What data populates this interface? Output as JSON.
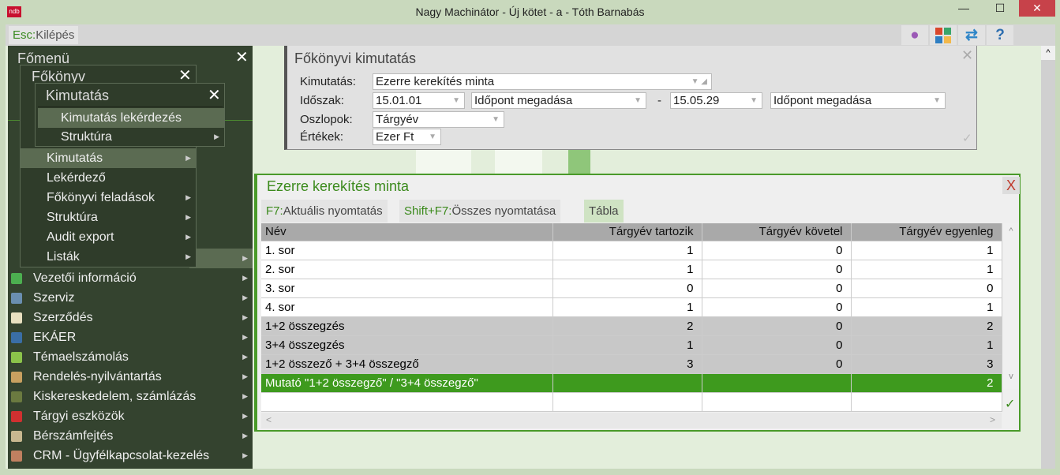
{
  "window": {
    "title": "Nagy Machinátor - Új kötet - a - Tóth Barnabás",
    "app_icon": "ndb",
    "minimize": "—",
    "maximize": "☐",
    "close": "✕"
  },
  "toolbar": {
    "esc_key": "Esc:",
    "esc_label": "Kilépés",
    "icons": [
      "user-icon",
      "tiles-icon",
      "swap-icon",
      "help-icon"
    ],
    "help": "?"
  },
  "main_menu": {
    "title": "Főmenü",
    "close": "✕",
    "items": [
      {
        "label": "Vezetői információ",
        "color": "#4caf50"
      },
      {
        "label": "Szerviz",
        "color": "#6a8fb0"
      },
      {
        "label": "Szerződés",
        "color": "#e8e0c0"
      },
      {
        "label": "EKÁER",
        "color": "#3a6ea5"
      },
      {
        "label": "Témaelszámolás",
        "color": "#8bc34a"
      },
      {
        "label": "Rendelés-nyilvántartás",
        "color": "#c8a060"
      },
      {
        "label": "Kiskereskedelem, számlázás",
        "color": "#6b7a40"
      },
      {
        "label": "Tárgyi eszközök",
        "color": "#d03030"
      },
      {
        "label": "Bérszámfejtés",
        "color": "#c8b890"
      },
      {
        "label": "CRM - Ügyfélkapcsolat-kezelés",
        "color": "#c08060"
      }
    ]
  },
  "fokonyv_menu": {
    "title": "Főkönyv",
    "close": "✕",
    "items": [
      "Kimutatás",
      "Lekérdező",
      "Főkönyvi feladások",
      "Struktúra",
      "Audit export",
      "Listák"
    ]
  },
  "kimutatas_menu": {
    "title": "Kimutatás",
    "close": "✕",
    "items": [
      "Kimutatás lekérdezés",
      "Struktúra"
    ]
  },
  "form": {
    "title": "Főkönyvi kimutatás",
    "close": "✕",
    "ok": "✓",
    "kimutatas_label": "Kimutatás:",
    "kimutatas_value": "Ezerre kerekítés minta",
    "idoszak_label": "Időszak:",
    "from_date": "15.01.01",
    "from_mode": "Időpont megadása",
    "dash": "-",
    "to_date": "15.05.29",
    "to_mode": "Időpont megadása",
    "oszlopok_label": "Oszlopok:",
    "oszlopok_value": "Tárgyév",
    "ertekek_label": "Értékek:",
    "ertekek_value": "Ezer Ft"
  },
  "result": {
    "title": "Ezerre kerekítés minta",
    "close": "X",
    "tabs": [
      {
        "key": "F7:",
        "label": "Aktuális nyomtatás"
      },
      {
        "key": "Shift+F7:",
        "label": "Összes nyomtatása"
      },
      {
        "key": "",
        "label": "Tábla"
      }
    ],
    "columns": [
      "Név",
      "Tárgyév tartozik",
      "Tárgyév követel",
      "Tárgyév egyenleg"
    ],
    "rows": [
      {
        "type": "norm",
        "cells": [
          "1. sor",
          "1",
          "0",
          "1"
        ]
      },
      {
        "type": "norm",
        "cells": [
          "2. sor",
          "1",
          "0",
          "1"
        ]
      },
      {
        "type": "norm",
        "cells": [
          "3. sor",
          "0",
          "0",
          "0"
        ]
      },
      {
        "type": "norm",
        "cells": [
          "4. sor",
          "1",
          "0",
          "1"
        ]
      },
      {
        "type": "sum",
        "cells": [
          "1+2 összegzés",
          "2",
          "0",
          "2"
        ]
      },
      {
        "type": "sum",
        "cells": [
          "3+4 összegzés",
          "1",
          "0",
          "1"
        ]
      },
      {
        "type": "sum",
        "cells": [
          "1+2 összező + 3+4 összegző",
          "3",
          "0",
          "3"
        ]
      },
      {
        "type": "sel",
        "cells": [
          "Mutató \"1+2 összegző\" / \"3+4 összegző\"",
          "",
          "",
          "2"
        ]
      },
      {
        "type": "norm",
        "cells": [
          "",
          "",
          "",
          ""
        ]
      }
    ],
    "ok": "✓"
  }
}
